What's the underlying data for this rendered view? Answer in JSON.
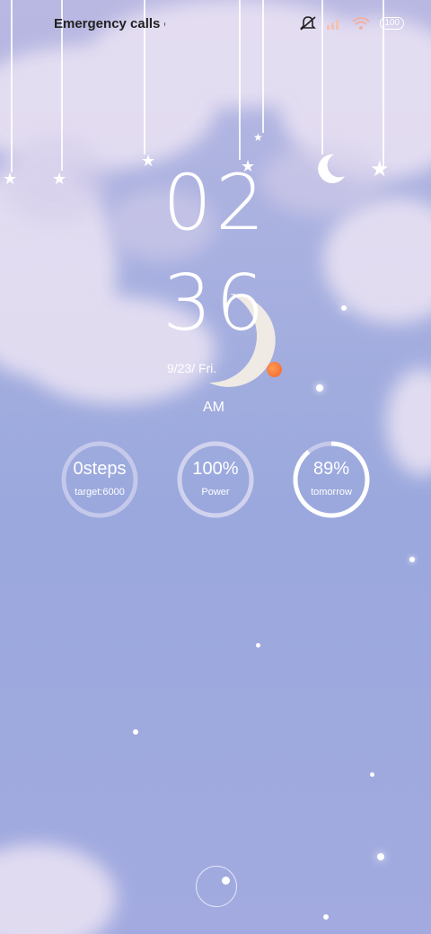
{
  "status_bar": {
    "emergency_text": "Emergency calls only",
    "battery": "100",
    "icons": [
      "bell-muted-icon",
      "signal-icon",
      "wifi-icon",
      "battery-icon"
    ]
  },
  "clock": {
    "hour": "02",
    "minute": "36",
    "date": "9/23/ Fri.",
    "ampm": "AM"
  },
  "widgets": [
    {
      "value": "0steps",
      "label": "target:6000",
      "progress": 0
    },
    {
      "value": "100%",
      "label": "Power",
      "progress": 1.0
    },
    {
      "value": "89%",
      "label": "tomorrow",
      "progress": 0.89
    }
  ],
  "colors": {
    "ring_track": "#d6d6f0",
    "ring_fill": "#ffffff",
    "sun": "#f0642a"
  }
}
